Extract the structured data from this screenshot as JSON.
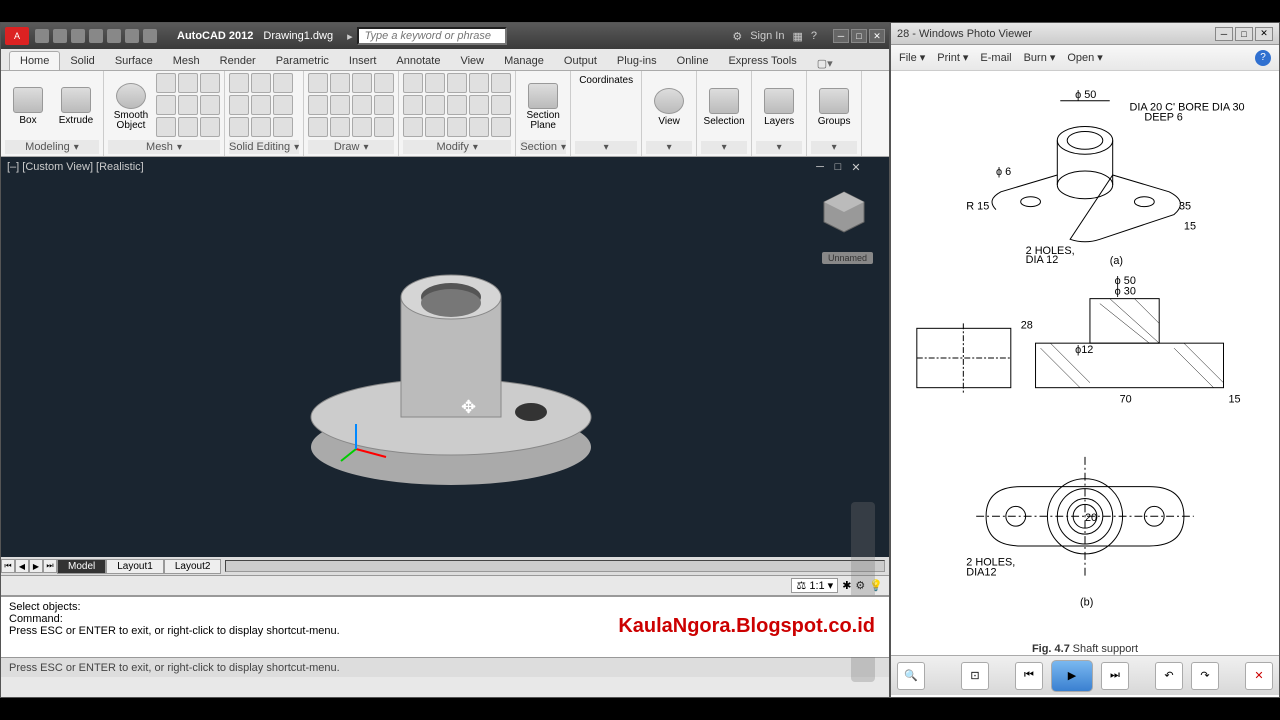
{
  "autocad": {
    "app_title": "AutoCAD 2012",
    "file_name": "Drawing1.dwg",
    "search_placeholder": "Type a keyword or phrase",
    "sign_in": "Sign In",
    "tabs": {
      "home": "Home",
      "solid": "Solid",
      "surface": "Surface",
      "mesh": "Mesh",
      "render": "Render",
      "parametric": "Parametric",
      "insert": "Insert",
      "annotate": "Annotate",
      "view": "View",
      "manage": "Manage",
      "output": "Output",
      "plugins": "Plug-ins",
      "online": "Online",
      "express": "Express Tools"
    },
    "ribbon": {
      "box": "Box",
      "extrude": "Extrude",
      "smooth": "Smooth Object",
      "section_plane": "Section Plane",
      "view": "View",
      "selection": "Selection",
      "layers": "Layers",
      "groups": "Groups",
      "coordinates": "Coordinates",
      "panel_modeling": "Modeling",
      "panel_mesh": "Mesh",
      "panel_solid_editing": "Solid Editing",
      "panel_draw": "Draw",
      "panel_modify": "Modify",
      "panel_section": "Section"
    },
    "viewport_label": "[‒] [Custom View] [Realistic]",
    "viewcube_label": "Unnamed",
    "model_tabs": {
      "model": "Model",
      "layout1": "Layout1",
      "layout2": "Layout2"
    },
    "scale": "1:1",
    "cmd": {
      "l1": "Select objects:",
      "l2": "Command:",
      "l3": "Press ESC or ENTER to exit, or right-click to display shortcut-menu."
    },
    "watermark": "KaulaNgora.Blogspot.co.id",
    "statusbar": "Press ESC or ENTER to exit, or right-click to display shortcut-menu."
  },
  "photo": {
    "title": "28 - Windows Photo Viewer",
    "menu": {
      "file": "File",
      "print": "Print",
      "email": "E-mail",
      "burn": "Burn",
      "open": "Open"
    },
    "annotations": {
      "dim1": "ϕ 50",
      "dim2": "DIA 20 C' BORE DIA 30",
      "dim3": "DEEP 6",
      "dim4": "ϕ 6",
      "dim5": "R 15",
      "dim6": "35",
      "dim7": "15",
      "dim8": "2 HOLES,",
      "dim9": "DIA 12",
      "a": "(a)",
      "b": "(b)",
      "dim50": "ϕ 50",
      "dim30": "ϕ 30",
      "dim28": "28",
      "dim12": "ϕ12",
      "dim70": "70",
      "dim15b": "15",
      "holes2": "2 HOLES,",
      "dia12b": "DIA12",
      "dim20": "20"
    },
    "caption_prefix": "Fig. 4.7",
    "caption": "Shaft support"
  }
}
